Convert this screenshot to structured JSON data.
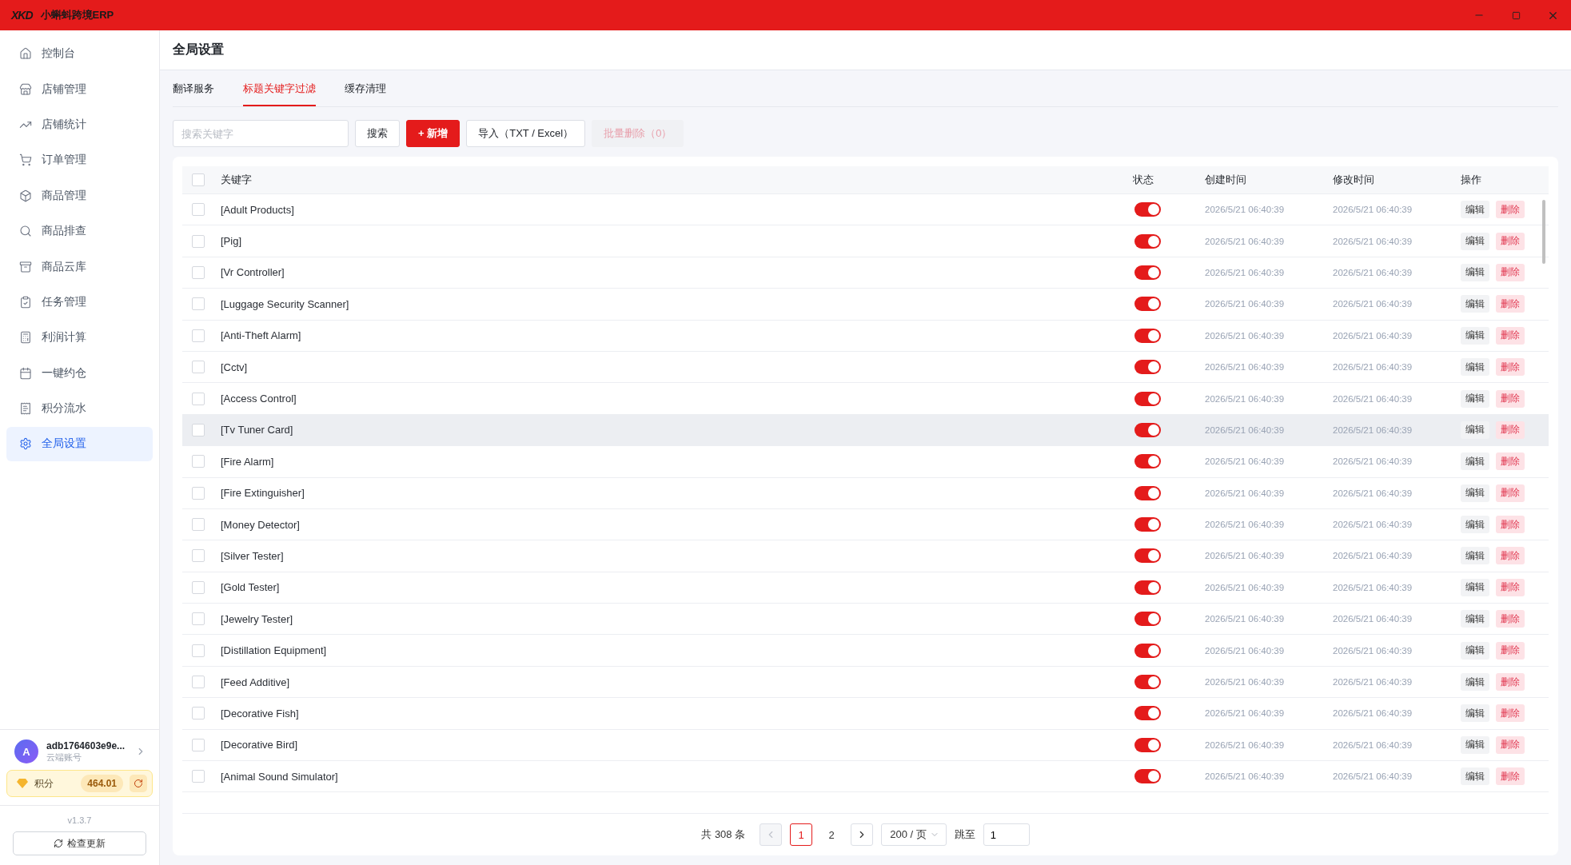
{
  "app": {
    "logo": "XKD",
    "title": "小蝌蚪跨境ERP"
  },
  "sidebar": {
    "items": [
      {
        "label": "控制台",
        "selected": false
      },
      {
        "label": "店铺管理",
        "selected": false
      },
      {
        "label": "店铺统计",
        "selected": false
      },
      {
        "label": "订单管理",
        "selected": false
      },
      {
        "label": "商品管理",
        "selected": false
      },
      {
        "label": "商品排查",
        "selected": false
      },
      {
        "label": "商品云库",
        "selected": false
      },
      {
        "label": "任务管理",
        "selected": false
      },
      {
        "label": "利润计算",
        "selected": false
      },
      {
        "label": "一键约仓",
        "selected": false
      },
      {
        "label": "积分流水",
        "selected": false
      },
      {
        "label": "全局设置",
        "selected": true
      }
    ],
    "user": {
      "avatar": "A",
      "name": "adb1764603e9e...",
      "subtitle": "云端账号"
    },
    "points": {
      "label": "积分",
      "value": "464.01"
    },
    "version": "v1.3.7",
    "update_button": "检查更新"
  },
  "page": {
    "title": "全局设置"
  },
  "tabs": [
    {
      "label": "翻译服务",
      "selected": false
    },
    {
      "label": "标题关键字过滤",
      "selected": true
    },
    {
      "label": "缓存清理",
      "selected": false
    }
  ],
  "toolbar": {
    "search": {
      "placeholder": "搜索关键字"
    },
    "buttons": [
      {
        "label": "搜索",
        "kind": "default"
      },
      {
        "label": "+ 新增",
        "kind": "primary"
      },
      {
        "label": "导入（TXT / Excel）",
        "kind": "default"
      },
      {
        "label": "批量删除（0）",
        "kind": "disabled"
      }
    ]
  },
  "table": {
    "columns": [
      "关键字",
      "状态",
      "创建时间",
      "修改时间",
      "操作"
    ],
    "header_checked": false,
    "rows": [
      {
        "keyword": "[Adult Products]",
        "checked": false,
        "enabled": true,
        "highlighted": false,
        "created": "2026/5/21 06:40:39",
        "modified": "2026/5/21 06:40:39",
        "actions": [
          "编辑",
          "删除"
        ]
      },
      {
        "keyword": "[Pig]",
        "checked": false,
        "enabled": true,
        "highlighted": false,
        "created": "2026/5/21 06:40:39",
        "modified": "2026/5/21 06:40:39",
        "actions": [
          "编辑",
          "删除"
        ]
      },
      {
        "keyword": "[Vr Controller]",
        "checked": false,
        "enabled": true,
        "highlighted": false,
        "created": "2026/5/21 06:40:39",
        "modified": "2026/5/21 06:40:39",
        "actions": [
          "编辑",
          "删除"
        ]
      },
      {
        "keyword": "[Luggage Security Scanner]",
        "checked": false,
        "enabled": true,
        "highlighted": false,
        "created": "2026/5/21 06:40:39",
        "modified": "2026/5/21 06:40:39",
        "actions": [
          "编辑",
          "删除"
        ]
      },
      {
        "keyword": "[Anti-Theft Alarm]",
        "checked": false,
        "enabled": true,
        "highlighted": false,
        "created": "2026/5/21 06:40:39",
        "modified": "2026/5/21 06:40:39",
        "actions": [
          "编辑",
          "删除"
        ]
      },
      {
        "keyword": "[Cctv]",
        "checked": false,
        "enabled": true,
        "highlighted": false,
        "created": "2026/5/21 06:40:39",
        "modified": "2026/5/21 06:40:39",
        "actions": [
          "编辑",
          "删除"
        ]
      },
      {
        "keyword": "[Access Control]",
        "checked": false,
        "enabled": true,
        "highlighted": false,
        "created": "2026/5/21 06:40:39",
        "modified": "2026/5/21 06:40:39",
        "actions": [
          "编辑",
          "删除"
        ]
      },
      {
        "keyword": "[Tv Tuner Card]",
        "checked": false,
        "enabled": true,
        "highlighted": true,
        "created": "2026/5/21 06:40:39",
        "modified": "2026/5/21 06:40:39",
        "actions": [
          "编辑",
          "删除"
        ]
      },
      {
        "keyword": "[Fire Alarm]",
        "checked": false,
        "enabled": true,
        "highlighted": false,
        "created": "2026/5/21 06:40:39",
        "modified": "2026/5/21 06:40:39",
        "actions": [
          "编辑",
          "删除"
        ]
      },
      {
        "keyword": "[Fire Extinguisher]",
        "checked": false,
        "enabled": true,
        "highlighted": false,
        "created": "2026/5/21 06:40:39",
        "modified": "2026/5/21 06:40:39",
        "actions": [
          "编辑",
          "删除"
        ]
      },
      {
        "keyword": "[Money Detector]",
        "checked": false,
        "enabled": true,
        "highlighted": false,
        "created": "2026/5/21 06:40:39",
        "modified": "2026/5/21 06:40:39",
        "actions": [
          "编辑",
          "删除"
        ]
      },
      {
        "keyword": "[Silver Tester]",
        "checked": false,
        "enabled": true,
        "highlighted": false,
        "created": "2026/5/21 06:40:39",
        "modified": "2026/5/21 06:40:39",
        "actions": [
          "编辑",
          "删除"
        ]
      },
      {
        "keyword": "[Gold Tester]",
        "checked": false,
        "enabled": true,
        "highlighted": false,
        "created": "2026/5/21 06:40:39",
        "modified": "2026/5/21 06:40:39",
        "actions": [
          "编辑",
          "删除"
        ]
      },
      {
        "keyword": "[Jewelry Tester]",
        "checked": false,
        "enabled": true,
        "highlighted": false,
        "created": "2026/5/21 06:40:39",
        "modified": "2026/5/21 06:40:39",
        "actions": [
          "编辑",
          "删除"
        ]
      },
      {
        "keyword": "[Distillation Equipment]",
        "checked": false,
        "enabled": true,
        "highlighted": false,
        "created": "2026/5/21 06:40:39",
        "modified": "2026/5/21 06:40:39",
        "actions": [
          "编辑",
          "删除"
        ]
      },
      {
        "keyword": "[Feed Additive]",
        "checked": false,
        "enabled": true,
        "highlighted": false,
        "created": "2026/5/21 06:40:39",
        "modified": "2026/5/21 06:40:39",
        "actions": [
          "编辑",
          "删除"
        ]
      },
      {
        "keyword": "[Decorative Fish]",
        "checked": false,
        "enabled": true,
        "highlighted": false,
        "created": "2026/5/21 06:40:39",
        "modified": "2026/5/21 06:40:39",
        "actions": [
          "编辑",
          "删除"
        ]
      },
      {
        "keyword": "[Decorative Bird]",
        "checked": false,
        "enabled": true,
        "highlighted": false,
        "created": "2026/5/21 06:40:39",
        "modified": "2026/5/21 06:40:39",
        "actions": [
          "编辑",
          "删除"
        ]
      },
      {
        "keyword": "[Animal Sound Simulator]",
        "checked": false,
        "enabled": true,
        "highlighted": false,
        "created": "2026/5/21 06:40:39",
        "modified": "2026/5/21 06:40:39",
        "actions": [
          "编辑",
          "删除"
        ]
      }
    ]
  },
  "pagination": {
    "total": "共 308 条",
    "prev_disabled": true,
    "pages": [
      {
        "label": "1",
        "selected": true
      },
      {
        "label": "2",
        "selected": false
      }
    ],
    "page_size": "200 / 页",
    "jump_label": "跳至",
    "jump_value": "1"
  }
}
